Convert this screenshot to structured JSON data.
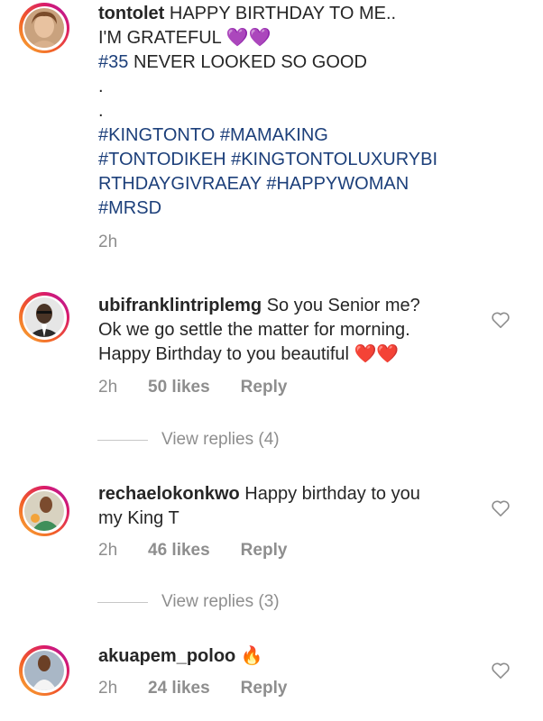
{
  "comments": [
    {
      "username": "tontolet",
      "text_line1": "HAPPY BIRTHDAY TO ME..",
      "text_line2": "I'M GRATEFUL",
      "emoji_line2": "💜💜",
      "hashtag_35": "#35",
      "text_line3": "NEVER LOOKED SO GOOD",
      "dot1": ".",
      "dot2": ".",
      "hashtags": [
        "#KINGTONTO #MAMAKING",
        "#TONTODIKEH #KINGTONTOLUXURYBI",
        "RTHDAYGIVRAEAY #HAPPYWOMAN",
        "#MRSD"
      ],
      "time": "2h"
    },
    {
      "username": "ubifranklintriplemg",
      "text_lines": [
        "So you Senior me?",
        "Ok we go settle the matter for morning.",
        "Happy Birthday to you beautiful"
      ],
      "emoji": "❤️❤️",
      "time": "2h",
      "likes": "50 likes",
      "reply": "Reply",
      "view_replies": "View replies (4)"
    },
    {
      "username": "rechaelokonkwo",
      "text_lines": [
        "Happy birthday to you",
        "my King T"
      ],
      "time": "2h",
      "likes": "46 likes",
      "reply": "Reply",
      "view_replies": "View replies (3)"
    },
    {
      "username": "akuapem_poloo",
      "emoji": "🔥",
      "time": "2h",
      "likes": "24 likes",
      "reply": "Reply"
    }
  ],
  "colors": {
    "hashtag": "#1c3f7a",
    "meta": "#8e8e8e",
    "text": "#262626"
  },
  "icons": [
    "heart-outline-icon"
  ]
}
